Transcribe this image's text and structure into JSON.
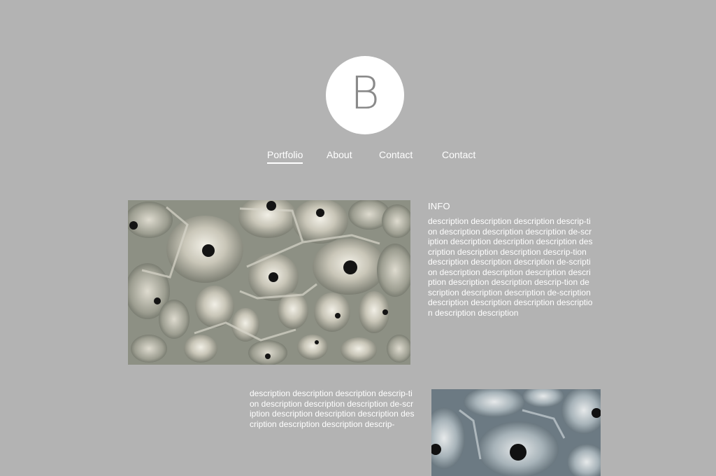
{
  "logo": {
    "letter": "B"
  },
  "nav": {
    "items": [
      {
        "label": "Portfolio",
        "active": true
      },
      {
        "label": "About",
        "active": false
      },
      {
        "label": "Contact",
        "active": false
      },
      {
        "label": "Contact",
        "active": false
      }
    ]
  },
  "info": {
    "title": "INFO",
    "description": "description description description descrip-tion description description description de-scription description description description description description description descrip-tion description description description de-scription description description description description description description descrip-tion description description description de-scription description description description description description description"
  },
  "second": {
    "description": "description description description descrip-tion description description description de-scription description description description description description description descrip-"
  },
  "colors": {
    "background": "#b3b3b3",
    "text": "#ffffff",
    "logo_circle": "#ffffff",
    "logo_letter": "#8a8a8a"
  },
  "images": [
    {
      "name": "cellular-ceiling-photo",
      "subject": "organic cellular ceiling sculpture"
    },
    {
      "name": "cellular-ceiling-photo-blue",
      "subject": "organic cellular ceiling sculpture, blue tint"
    }
  ]
}
